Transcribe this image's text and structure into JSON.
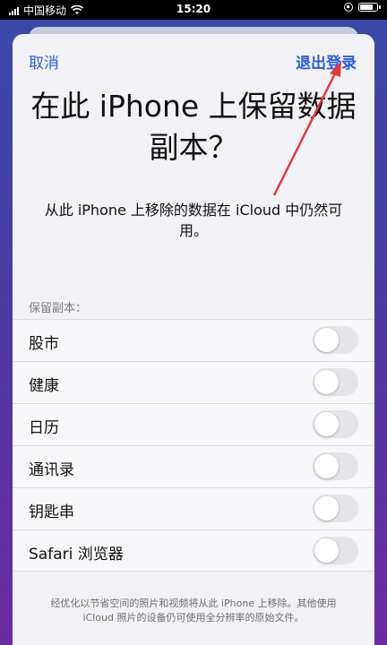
{
  "status_bar": {
    "carrier": "中国移动",
    "time": "15:20",
    "battery_level": 0.85
  },
  "nav": {
    "cancel_label": "取消",
    "logout_label": "退出登录"
  },
  "title": "在此 iPhone 上保留数据副本？",
  "subtitle": "从此 iPhone 上移除的数据在 iCloud 中仍然可用。",
  "section_header": "保留副本：",
  "items": [
    {
      "label": "股市",
      "on": false
    },
    {
      "label": "健康",
      "on": false
    },
    {
      "label": "日历",
      "on": false
    },
    {
      "label": "通讯录",
      "on": false
    },
    {
      "label": "钥匙串",
      "on": false
    },
    {
      "label": "Safari 浏览器",
      "on": false
    }
  ],
  "footer": "经优化以节省空间的照片和视频将从此 iPhone 上移除。其他使用 iCloud 照片的设备仍可使用全分辨率的原始文件。",
  "colors": {
    "accent": "#2b5fd9",
    "annotation_arrow": "#e03a3a"
  }
}
